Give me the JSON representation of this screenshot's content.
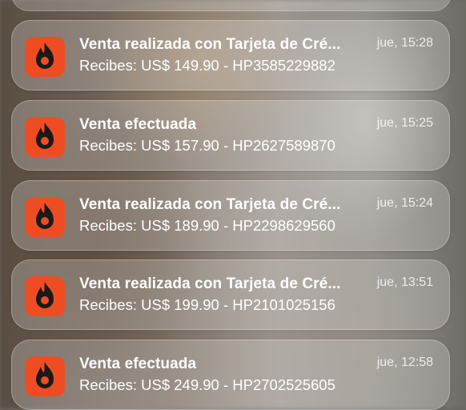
{
  "app": {
    "icon": "hotmart-flame-icon",
    "icon_color": "#ee4d23"
  },
  "notifications": [
    {
      "title": "Venta realizada con Tarjeta de Cré...",
      "time": "jue, 15:28",
      "body": "Recibes: US$ 149.90 - HP3585229882"
    },
    {
      "title": "Venta efectuada",
      "time": "jue, 15:25",
      "body": "Recibes: US$ 157.90 - HP2627589870"
    },
    {
      "title": "Venta realizada con Tarjeta de Cré...",
      "time": "jue, 15:24",
      "body": "Recibes: US$ 189.90 - HP2298629560"
    },
    {
      "title": "Venta realizada con Tarjeta de Cré...",
      "time": "jue, 13:51",
      "body": "Recibes: US$ 199.90 - HP2101025156"
    },
    {
      "title": "Venta efectuada",
      "time": "jue, 12:58",
      "body": "Recibes: US$ 249.90 - HP2702525605"
    }
  ]
}
